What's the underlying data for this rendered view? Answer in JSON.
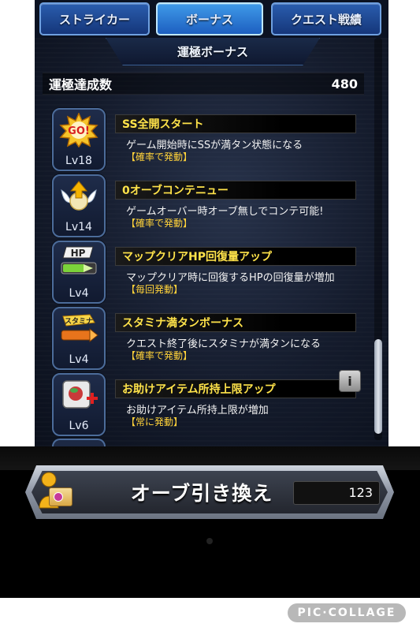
{
  "tabs": [
    {
      "label": "ストライカー",
      "active": false
    },
    {
      "label": "ボーナス",
      "active": true
    },
    {
      "label": "クエスト戦績",
      "active": false
    }
  ],
  "section_title": "運極ボーナス",
  "unkyoku_count": {
    "label": "運極達成数",
    "value": "480"
  },
  "bonuses": [
    {
      "icon": "go-icon",
      "level": "Lv18",
      "title": "SS全開スタート",
      "description": "ゲーム開始時にSSが満タン状態になる",
      "trigger": "【確率で発動】",
      "has_info": false
    },
    {
      "icon": "winged-orb-icon",
      "level": "Lv14",
      "title": "0オーブコンテニュー",
      "description": "ゲームオーバー時オーブ無しでコンテ可能!",
      "trigger": "【確率で発動】",
      "has_info": false
    },
    {
      "icon": "hp-gauge-icon",
      "level": "Lv4",
      "title": "マップクリアHP回復量アップ",
      "description": "マップクリア時に回復するHPの回復量が増加",
      "trigger": "【毎回発動】",
      "has_info": false
    },
    {
      "icon": "stamina-icon",
      "level": "Lv4",
      "title": "スタミナ満タンボーナス",
      "description": "クエスト終了後にスタミナが満タンになる",
      "trigger": "【確率で発動】",
      "has_info": false
    },
    {
      "icon": "item-plus-icon",
      "level": "Lv6",
      "title": "お助けアイテム所持上限アップ",
      "description": "お助けアイテム所持上限が増加",
      "trigger": "【常に発動】",
      "has_info": true,
      "info_label": "i"
    }
  ],
  "orb_exchange": {
    "label": "オーブ引き換え",
    "count": "123"
  },
  "watermark": "PIC·COLLAGE",
  "colors": {
    "title_yellow": "#ffe34a",
    "trigger_yellow": "#ffd23a",
    "tab_blue": "#2a5dae",
    "tab_active": "#3f9ae8"
  }
}
